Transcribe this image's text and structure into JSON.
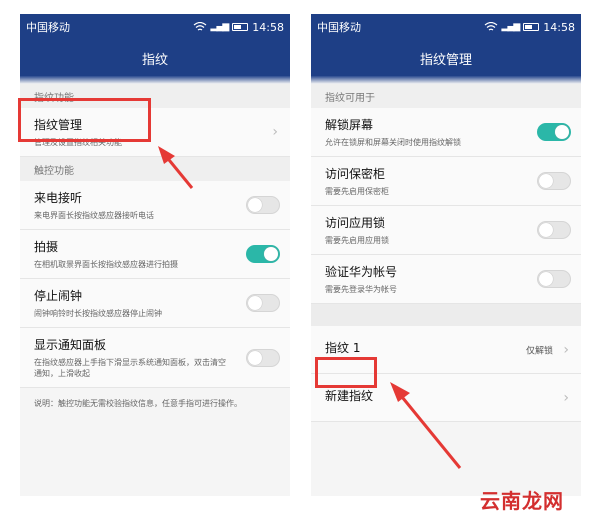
{
  "status_bar": {
    "carrier": "中国移动",
    "time": "14:58"
  },
  "left_screen": {
    "title": "指纹",
    "section1": "指纹功能",
    "manage": {
      "title": "指纹管理",
      "subtitle": "管理及设置指纹相关功能"
    },
    "section2": "触控功能",
    "items": [
      {
        "title": "来电接听",
        "subtitle": "来电界面长按指纹感应器接听电话",
        "toggle": false
      },
      {
        "title": "拍摄",
        "subtitle": "在相机取景界面长按指纹感应器进行拍摄",
        "toggle": true
      },
      {
        "title": "停止闹钟",
        "subtitle": "闹钟响铃时长按指纹感应器停止闹钟",
        "toggle": false
      },
      {
        "title": "显示通知面板",
        "subtitle": "在指纹感应器上手指下滑显示系统通知面板，双击清空通知，上滑收起",
        "toggle": false
      }
    ],
    "note": "说明：触控功能无需校验指纹信息，任意手指可进行操作。"
  },
  "right_screen": {
    "title": "指纹管理",
    "section1": "指纹可用于",
    "items": [
      {
        "title": "解锁屏幕",
        "subtitle": "允许在锁屏和屏幕关闭时使用指纹解锁",
        "toggle": true
      },
      {
        "title": "访问保密柜",
        "subtitle": "需要先启用保密柜",
        "toggle": false
      },
      {
        "title": "访问应用锁",
        "subtitle": "需要先启用应用锁",
        "toggle": false
      },
      {
        "title": "验证华为帐号",
        "subtitle": "需要先登录华为帐号",
        "toggle": false
      }
    ],
    "fingerprint1": {
      "label": "指纹 1",
      "value": "仅解锁"
    },
    "new_fingerprint": "新建指纹"
  },
  "watermark": "云南龙网",
  "colors": {
    "header": "#1e3f86",
    "toggle_on": "#2bb7a8",
    "highlight": "#e53935"
  }
}
